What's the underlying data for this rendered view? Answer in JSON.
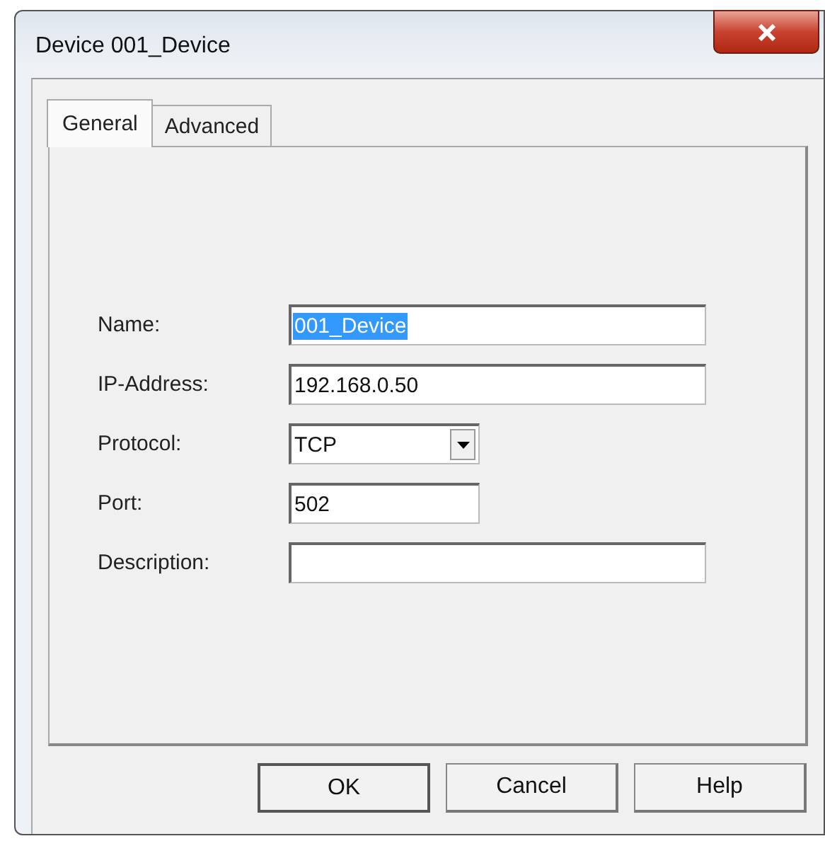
{
  "window": {
    "title": "Device 001_Device"
  },
  "tabs": [
    {
      "label": "General",
      "selected": true
    },
    {
      "label": "Advanced",
      "selected": false
    }
  ],
  "fields": [
    {
      "label": "Name:",
      "kind": "text",
      "value": "001_Device",
      "text_selected": true
    },
    {
      "label": "IP-Address:",
      "kind": "text",
      "value": "192.168.0.50"
    },
    {
      "label": "Protocol:",
      "kind": "select",
      "value": "TCP"
    },
    {
      "label": "Port:",
      "kind": "short-text",
      "value": "502"
    },
    {
      "label": "Description:",
      "kind": "text"
    }
  ],
  "buttons": [
    {
      "label": "OK",
      "default": true
    },
    {
      "label": "Cancel",
      "default": false
    },
    {
      "label": "Help",
      "default": false
    }
  ]
}
